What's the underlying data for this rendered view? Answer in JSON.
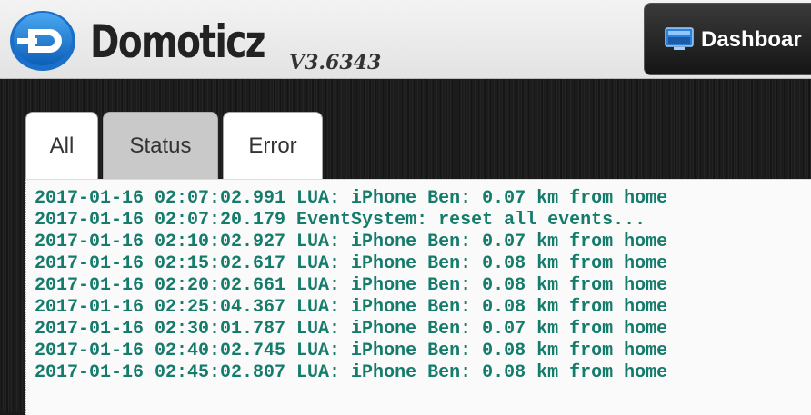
{
  "header": {
    "app_name": "Domoticz",
    "version": "V3.6343",
    "dashboard_label": "Dashboar",
    "dashboard_icon": "dashboard-monitor-icon"
  },
  "tabs": [
    {
      "label": "All",
      "active": true
    },
    {
      "label": "Status",
      "active": false
    },
    {
      "label": "Error",
      "active": false
    }
  ],
  "log": {
    "lines": [
      "2017-01-16 02:07:02.991 LUA: iPhone Ben: 0.07 km from home",
      "2017-01-16 02:07:20.179 EventSystem: reset all events...",
      "2017-01-16 02:10:02.927 LUA: iPhone Ben: 0.07 km from home",
      "2017-01-16 02:15:02.617 LUA: iPhone Ben: 0.08 km from home",
      "2017-01-16 02:20:02.661 LUA: iPhone Ben: 0.08 km from home",
      "2017-01-16 02:25:04.367 LUA: iPhone Ben: 0.08 km from home",
      "2017-01-16 02:30:01.787 LUA: iPhone Ben: 0.07 km from home",
      "2017-01-16 02:40:02.745 LUA: iPhone Ben: 0.08 km from home",
      "2017-01-16 02:45:02.807 LUA: iPhone Ben: 0.08 km from home"
    ],
    "text_color": "#157c6c"
  }
}
